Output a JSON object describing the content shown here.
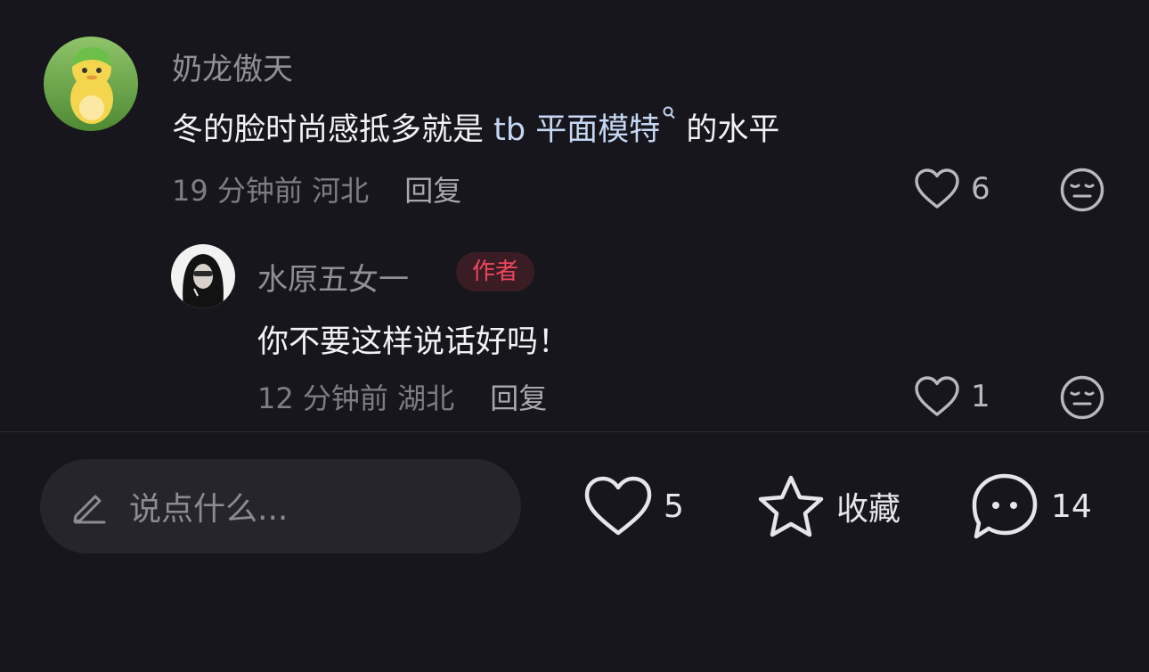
{
  "comments": [
    {
      "username": "奶龙傲天",
      "text_before": "冬的脸时尚感抵多就是 ",
      "keyword": "tb 平面模特",
      "text_after": " 的水平",
      "time": "19 分钟前",
      "location": "河北",
      "reply_label": "回复",
      "likes": "6"
    },
    {
      "username": "水原五女一",
      "badge": "作者",
      "text": "你不要这样说话好吗！",
      "time": "12 分钟前",
      "location": "湖北",
      "reply_label": "回复",
      "likes": "1"
    }
  ],
  "bottom_bar": {
    "input_placeholder": "说点什么...",
    "like_count": "5",
    "collect_label": "收藏",
    "comment_count": "14"
  },
  "colors": {
    "background": "#17161c",
    "keyword": "#c5d7f2",
    "author_badge_text": "#f0455e",
    "author_badge_bg": "#3a1d24"
  }
}
